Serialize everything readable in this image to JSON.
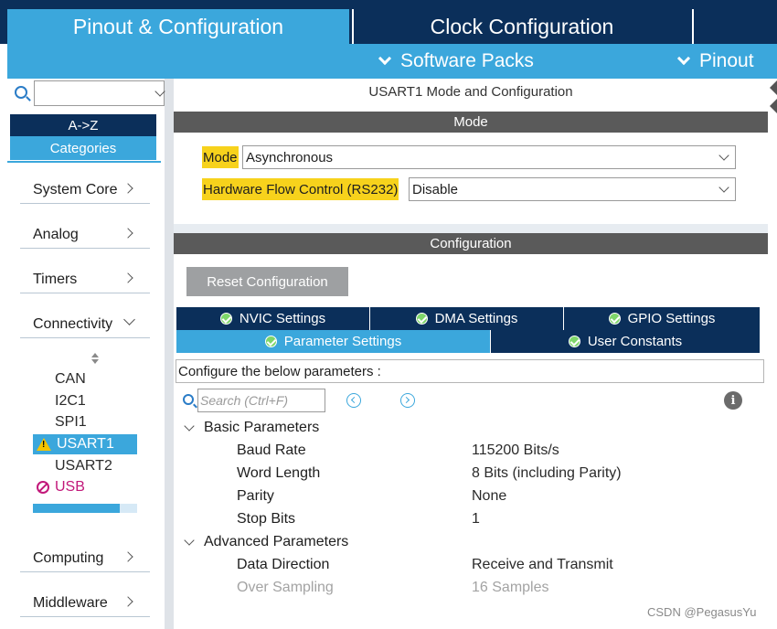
{
  "top_tabs": {
    "pinout": "Pinout & Configuration",
    "clock": "Clock Configuration"
  },
  "sub_bar": {
    "software_packs": "Software Packs",
    "pinout": "Pinout"
  },
  "left": {
    "search_value": "",
    "sort_az": "A->Z",
    "categories": "Categories",
    "items": [
      {
        "label": "System Core"
      },
      {
        "label": "Analog"
      },
      {
        "label": "Timers"
      },
      {
        "label": "Connectivity"
      }
    ],
    "peripherals": [
      {
        "label": "CAN"
      },
      {
        "label": "I2C1"
      },
      {
        "label": "SPI1"
      },
      {
        "label": "USART1"
      },
      {
        "label": "USART2"
      },
      {
        "label": "USB"
      }
    ],
    "lower_items": [
      {
        "label": "Computing"
      },
      {
        "label": "Middleware"
      }
    ],
    "scroll_fraction": 0.83
  },
  "main": {
    "title": "USART1 Mode and Configuration",
    "mode_header": "Mode",
    "mode_label": "Mode",
    "mode_value": "Asynchronous",
    "hw_flow_label": "Hardware Flow Control (RS232)",
    "hw_flow_value": "Disable",
    "config_header": "Configuration",
    "reset_button": "Reset Configuration",
    "tabs": {
      "nvic": "NVIC Settings",
      "dma": "DMA Settings",
      "gpio": "GPIO Settings",
      "parameter": "Parameter Settings",
      "user_constants": "User Constants"
    },
    "configure_text": "Configure the below parameters :",
    "search_placeholder": "Search (Ctrl+F)",
    "groups": {
      "basic": "Basic Parameters",
      "advanced": "Advanced Parameters"
    },
    "basic_params": [
      {
        "name": "Baud Rate",
        "value": "115200 Bits/s"
      },
      {
        "name": "Word Length",
        "value": "8 Bits (including Parity)"
      },
      {
        "name": "Parity",
        "value": "None"
      },
      {
        "name": "Stop Bits",
        "value": "1"
      }
    ],
    "advanced_params": [
      {
        "name": "Data Direction",
        "value": "Receive and Transmit"
      },
      {
        "name": "Over Sampling",
        "value": "16 Samples"
      }
    ]
  },
  "watermark": "CSDN @PegasusYu",
  "colors": {
    "navy": "#0b2f5a",
    "accent_blue": "#3ba7dc",
    "highlight_yellow": "#f7d21c",
    "section_gray": "#5a5a5a",
    "usb_magenta": "#c2187a"
  }
}
